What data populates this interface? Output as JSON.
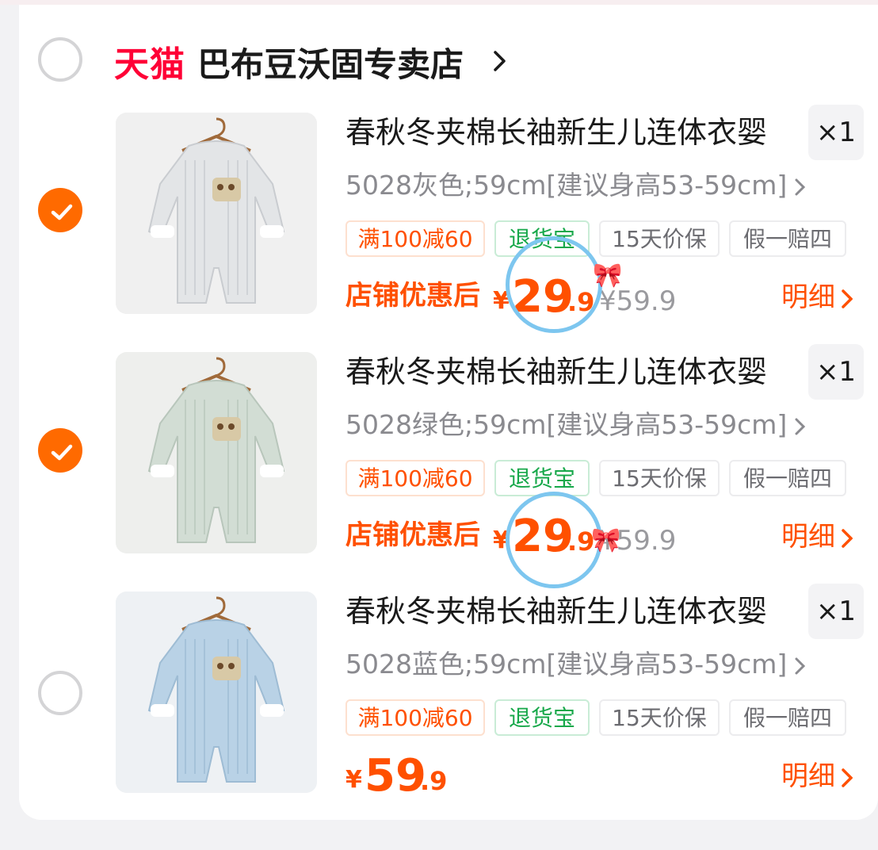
{
  "shop": {
    "logo_text": "天猫",
    "name": "巴布豆沃固专卖店",
    "selected": false
  },
  "items": [
    {
      "selected": true,
      "title": "春秋冬夹棉长袖新生儿连体衣婴",
      "quantity": "×1",
      "sku": "5028灰色;59cm[建议身高53-59cm]",
      "tags": [
        "满100减60",
        "退货宝",
        "15天价保",
        "假一赔四"
      ],
      "promo_label": "店铺优惠后",
      "currency": "¥",
      "price_int": "29",
      "price_dec": ".9",
      "original_price": "¥59.9",
      "detail_label": "明细",
      "color": "grey"
    },
    {
      "selected": true,
      "title": "春秋冬夹棉长袖新生儿连体衣婴",
      "quantity": "×1",
      "sku": "5028绿色;59cm[建议身高53-59cm]",
      "tags": [
        "满100减60",
        "退货宝",
        "15天价保",
        "假一赔四"
      ],
      "promo_label": "店铺优惠后",
      "currency": "¥",
      "price_int": "29",
      "price_dec": ".9",
      "original_price": "¥59.9",
      "detail_label": "明细",
      "color": "green"
    },
    {
      "selected": false,
      "title": "春秋冬夹棉长袖新生儿连体衣婴",
      "quantity": "×1",
      "sku": "5028蓝色;59cm[建议身高53-59cm]",
      "tags": [
        "满100减60",
        "退货宝",
        "15天价保",
        "假一赔四"
      ],
      "currency": "¥",
      "price_int": "59",
      "price_dec": ".9",
      "detail_label": "明细",
      "color": "blue"
    }
  ],
  "icons": {
    "check": "check-icon",
    "chevron": "chevron-right-icon",
    "bow": "bow-decoration-icon"
  },
  "colors": {
    "accent": "#ff5000",
    "checkbox": "#ff6a00",
    "tmall": "#ff0036",
    "tag_green": "#17a84a",
    "circle_annotation": "#7dc6ef"
  }
}
